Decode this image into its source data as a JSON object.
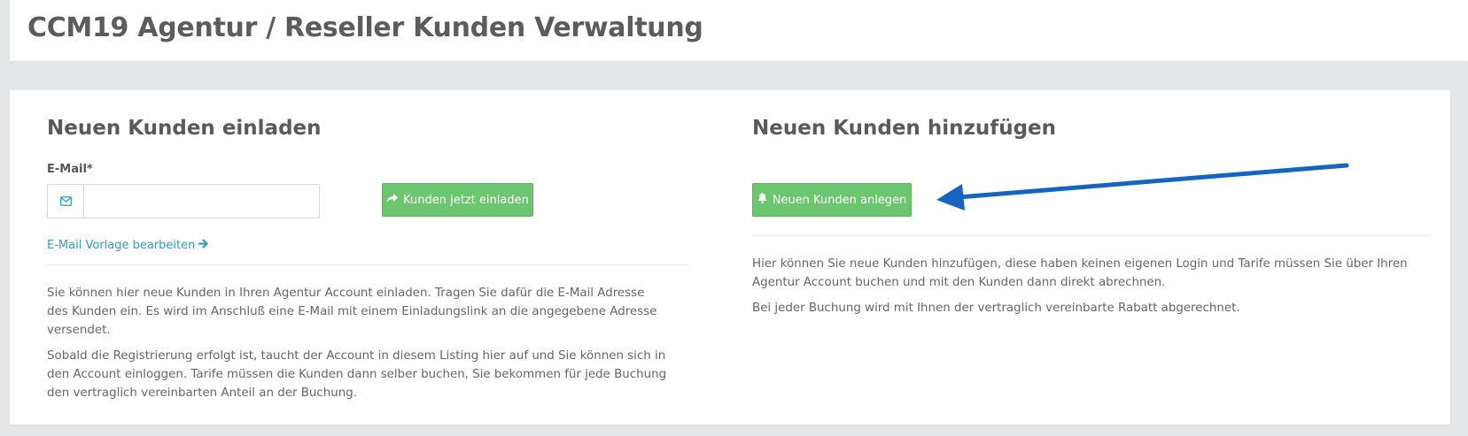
{
  "header": {
    "title": "CCM19 Agentur / Reseller Kunden Verwaltung"
  },
  "invite": {
    "heading": "Neuen Kunden einladen",
    "email_label": "E-Mail*",
    "email_value": "",
    "envelope_icon": "envelope-icon",
    "button_icon": "share-arrow-icon",
    "button_label": "Kunden jetzt einladen",
    "template_link": "E-Mail Vorlage bearbeiten",
    "template_link_icon": "arrow-right-icon",
    "paragraph1": "Sie können hier neue Kunden in Ihren Agentur Account einladen. Tragen Sie dafür die E-Mail Adresse des Kunden ein. Es wird im Anschluß eine E-Mail mit einem Einladungslink an die angegebene Adresse versendet.",
    "paragraph2": "Sobald die Registrierung erfolgt ist, taucht der Account in diesem Listing hier auf und Sie können sich in den Account einloggen. Tarife müssen die Kunden dann selber buchen, Sie bekommen für jede Buchung den vertraglich vereinbarten Anteil an der Buchung."
  },
  "add": {
    "heading": "Neuen Kunden hinzufügen",
    "button_icon": "bell-icon",
    "button_label": "Neuen Kunden anlegen",
    "paragraph1": "Hier können Sie neue Kunden hinzufügen, diese haben keinen eigenen Login und Tarife müssen Sie über Ihren Agentur Account buchen und mit den Kunden dann direkt abrechnen.",
    "paragraph2": "Bei jeder Buchung wird mit Ihnen der vertraglich vereinbarte Rabatt abgerechnet."
  },
  "annotation": {
    "arrow_icon": "annotation-arrow",
    "arrow_color": "#1565c0"
  },
  "colors": {
    "button_green": "#6cc66f",
    "link_blue": "#2a9fc0",
    "page_background": "#e6e7e8"
  }
}
